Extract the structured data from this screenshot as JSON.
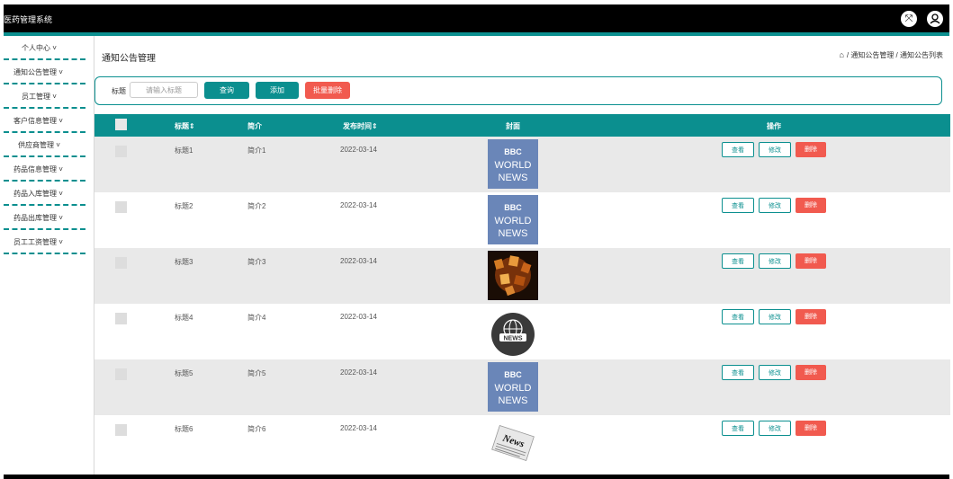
{
  "app": {
    "title": "医药管理系统"
  },
  "sidebar": {
    "items": [
      {
        "label": "个人中心 ˅"
      },
      {
        "label": "通知公告管理 ˅"
      },
      {
        "label": "员工管理 ˅"
      },
      {
        "label": "客户信息管理 ˅"
      },
      {
        "label": "供应商管理 ˅"
      },
      {
        "label": "药品信息管理 ˅"
      },
      {
        "label": "药品入库管理 ˅"
      },
      {
        "label": "药品出库管理 ˅"
      },
      {
        "label": "员工工资管理 ˅"
      }
    ]
  },
  "page": {
    "title": "通知公告管理",
    "breadcrumb": "/ 通知公告管理 / 通知公告列表"
  },
  "search": {
    "label": "标题",
    "placeholder": "请输入标题",
    "query_label": "查询",
    "add_label": "添加",
    "batch_delete_label": "批量删除"
  },
  "table": {
    "headers": {
      "title": "标题⇕",
      "intro": "简介",
      "date": "发布时间⇕",
      "cover": "封面",
      "ops": "操作"
    },
    "rows": [
      {
        "title": "标题1",
        "intro": "简介1",
        "date": "2022-03-14",
        "cover": "bbc",
        "view": "查看",
        "edit": "修改",
        "del": "删除"
      },
      {
        "title": "标题2",
        "intro": "简介2",
        "date": "2022-03-14",
        "cover": "bbc",
        "view": "查看",
        "edit": "修改",
        "del": "删除"
      },
      {
        "title": "标题3",
        "intro": "简介3",
        "date": "2022-03-14",
        "cover": "letters",
        "view": "查看",
        "edit": "修改",
        "del": "删除"
      },
      {
        "title": "标题4",
        "intro": "简介4",
        "date": "2022-03-14",
        "cover": "globe",
        "view": "查看",
        "edit": "修改",
        "del": "删除"
      },
      {
        "title": "标题5",
        "intro": "简介5",
        "date": "2022-03-14",
        "cover": "bbc",
        "view": "查看",
        "edit": "修改",
        "del": "删除"
      },
      {
        "title": "标题6",
        "intro": "简介6",
        "date": "2022-03-14",
        "cover": "paper",
        "view": "查看",
        "edit": "修改",
        "del": "删除"
      }
    ]
  },
  "covers": {
    "bbc_logo": "BBC",
    "bbc_line1": "WORLD",
    "bbc_line2": "NEWS",
    "globe_text": "NEWS",
    "paper_text": "News"
  },
  "colors": {
    "accent": "#0b8f8f",
    "danger": "#f15a4f",
    "topbar": "#000000"
  },
  "icons": {
    "fullscreen": "fullscreen-icon",
    "user": "user-icon",
    "home": "home-icon"
  }
}
